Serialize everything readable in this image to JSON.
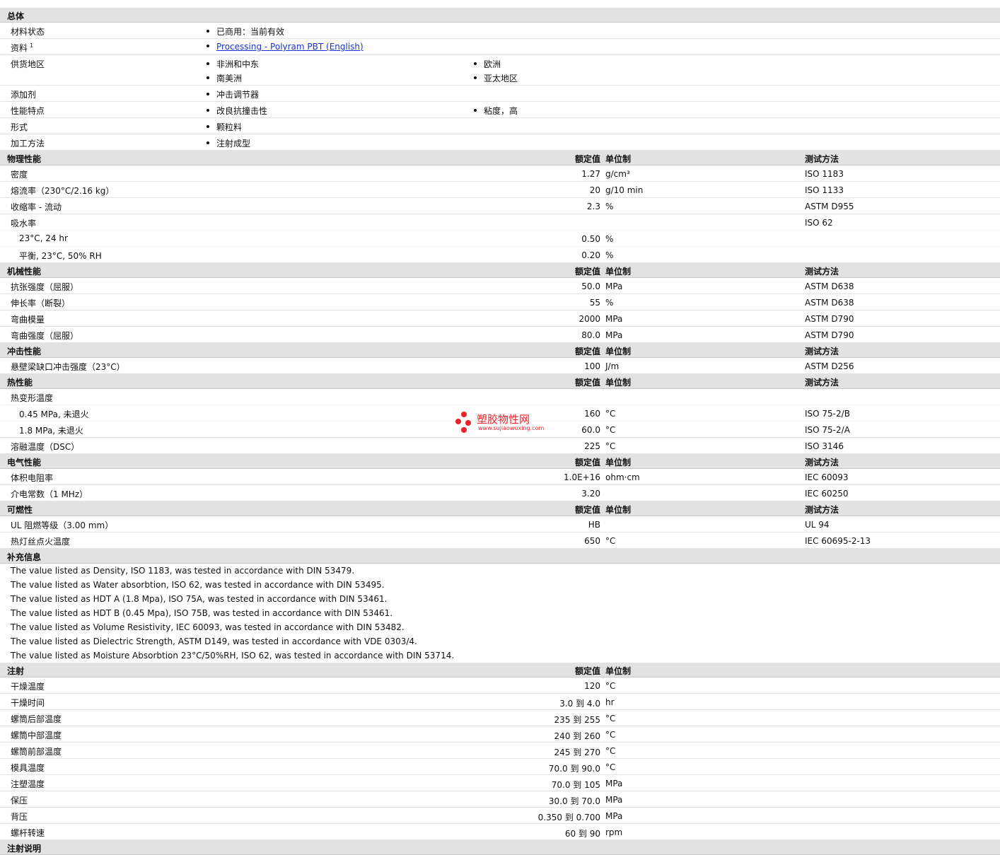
{
  "overview": {
    "title": "总体",
    "material_status": {
      "label": "材料状态",
      "value": "已商用：当前有效"
    },
    "documents": {
      "label": "资料",
      "sup": "1",
      "link": "Processing - Polyram PBT (English)"
    },
    "supply": {
      "label": "供货地区",
      "items": [
        "非洲和中东",
        "欧洲",
        "南美洲",
        "亚太地区"
      ]
    },
    "additive": {
      "label": "添加剂",
      "value": "冲击调节器"
    },
    "features": {
      "label": "性能特点",
      "items": [
        "改良抗撞击性",
        "粘度，高"
      ]
    },
    "form": {
      "label": "形式",
      "value": "颗粒料"
    },
    "processing": {
      "label": "加工方法",
      "value": "注射成型"
    }
  },
  "col": {
    "value": "额定值",
    "unit": "单位制",
    "method": "测试方法"
  },
  "physical": {
    "title": "物理性能",
    "rows": [
      {
        "label": "密度",
        "value": "1.27",
        "unit": "g/cm³",
        "method": "ISO 1183"
      },
      {
        "label": "熔流率（230°C/2.16 kg）",
        "value": "20",
        "unit": "g/10 min",
        "method": "ISO 1133"
      },
      {
        "label": "收缩率 - 流动",
        "value": "2.3",
        "unit": "%",
        "method": "ASTM D955"
      },
      {
        "label": "吸水率",
        "value": "",
        "unit": "",
        "method": "ISO 62"
      }
    ],
    "subrows": [
      {
        "label": "23°C, 24 hr",
        "value": "0.50",
        "unit": "%"
      },
      {
        "label": "平衡, 23°C, 50% RH",
        "value": "0.20",
        "unit": "%"
      }
    ]
  },
  "mechanical": {
    "title": "机械性能",
    "rows": [
      {
        "label": "抗张强度（屈服）",
        "value": "50.0",
        "unit": "MPa",
        "method": "ASTM D638"
      },
      {
        "label": "伸长率（断裂）",
        "value": "55",
        "unit": "%",
        "method": "ASTM D638"
      },
      {
        "label": "弯曲模量",
        "value": "2000",
        "unit": "MPa",
        "method": "ASTM D790"
      },
      {
        "label": "弯曲强度（屈服）",
        "value": "80.0",
        "unit": "MPa",
        "method": "ASTM D790"
      }
    ]
  },
  "impact": {
    "title": "冲击性能",
    "rows": [
      {
        "label": "悬壁梁缺口冲击强度（23°C）",
        "value": "100",
        "unit": "J/m",
        "method": "ASTM D256"
      }
    ]
  },
  "thermal": {
    "title": "热性能",
    "hdt_label": "热变形温度",
    "subrows": [
      {
        "label": "0.45 MPa, 未退火",
        "value": "160",
        "unit": "°C",
        "method": "ISO 75-2/B"
      },
      {
        "label": "1.8 MPa, 未退火",
        "value": "60.0",
        "unit": "°C",
        "method": "ISO 75-2/A"
      }
    ],
    "melt": {
      "label": "溶融温度（DSC）",
      "value": "225",
      "unit": "°C",
      "method": "ISO 3146"
    }
  },
  "electrical": {
    "title": "电气性能",
    "rows": [
      {
        "label": "体积电阻率",
        "value": "1.0E+16",
        "unit": "ohm·cm",
        "method": "IEC 60093"
      },
      {
        "label": "介电常数（1 MHz）",
        "value": "3.20",
        "unit": "",
        "method": "IEC 60250"
      }
    ]
  },
  "flammability": {
    "title": "可燃性",
    "rows": [
      {
        "label": "UL 阻燃等级（3.00 mm）",
        "value": "HB",
        "unit": "",
        "method": "UL 94"
      },
      {
        "label": "热灯丝点火温度",
        "value": "650",
        "unit": "°C",
        "method": "IEC 60695-2-13"
      }
    ]
  },
  "supplement": {
    "title": "补充信息",
    "notes": [
      "The value listed as Density, ISO 1183, was tested in accordance with DIN 53479.",
      "The value listed as Water absorbtion, ISO 62, was tested in accordance with DIN 53495.",
      "The value listed as HDT A (1.8 Mpa), ISO 75A, was tested in accordance with DIN 53461.",
      "The value listed as HDT B (0.45 Mpa), ISO 75B, was tested in accordance with DIN 53461.",
      "The value listed as Volume Resistivity, IEC 60093, was tested in accordance with DIN 53482.",
      "The value listed as Dielectric Strength, ASTM D149, was tested in accordance with VDE 0303/4.",
      "The value listed as Moisture Absorbtion 23°C/50%RH, ISO 62, was tested in accordance with DIN 53714."
    ]
  },
  "injection": {
    "title": "注射",
    "rows": [
      {
        "label": "干燥温度",
        "value": "120",
        "unit": "°C"
      },
      {
        "label": "干燥时间",
        "value": "3.0 到  4.0",
        "unit": "hr"
      },
      {
        "label": "螺筒后部温度",
        "value": "235 到  255",
        "unit": "°C"
      },
      {
        "label": "螺筒中部温度",
        "value": "240 到  260",
        "unit": "°C"
      },
      {
        "label": "螺筒前部温度",
        "value": "245 到  270",
        "unit": "°C"
      },
      {
        "label": "模具温度",
        "value": "70.0 到  90.0",
        "unit": "°C"
      },
      {
        "label": "注塑温度",
        "value": "70.0 到  105",
        "unit": "MPa"
      },
      {
        "label": "保压",
        "value": "30.0 到  70.0",
        "unit": "MPa"
      },
      {
        "label": "背压",
        "value": "0.350 到  0.700",
        "unit": "MPa"
      },
      {
        "label": "螺杆转速",
        "value": "60 到  90",
        "unit": "rpm"
      }
    ]
  },
  "injection_notes": {
    "title": "注射说明"
  },
  "watermark": {
    "cn": "塑胶物性网",
    "en": "www.sujiaowuxing.com"
  }
}
